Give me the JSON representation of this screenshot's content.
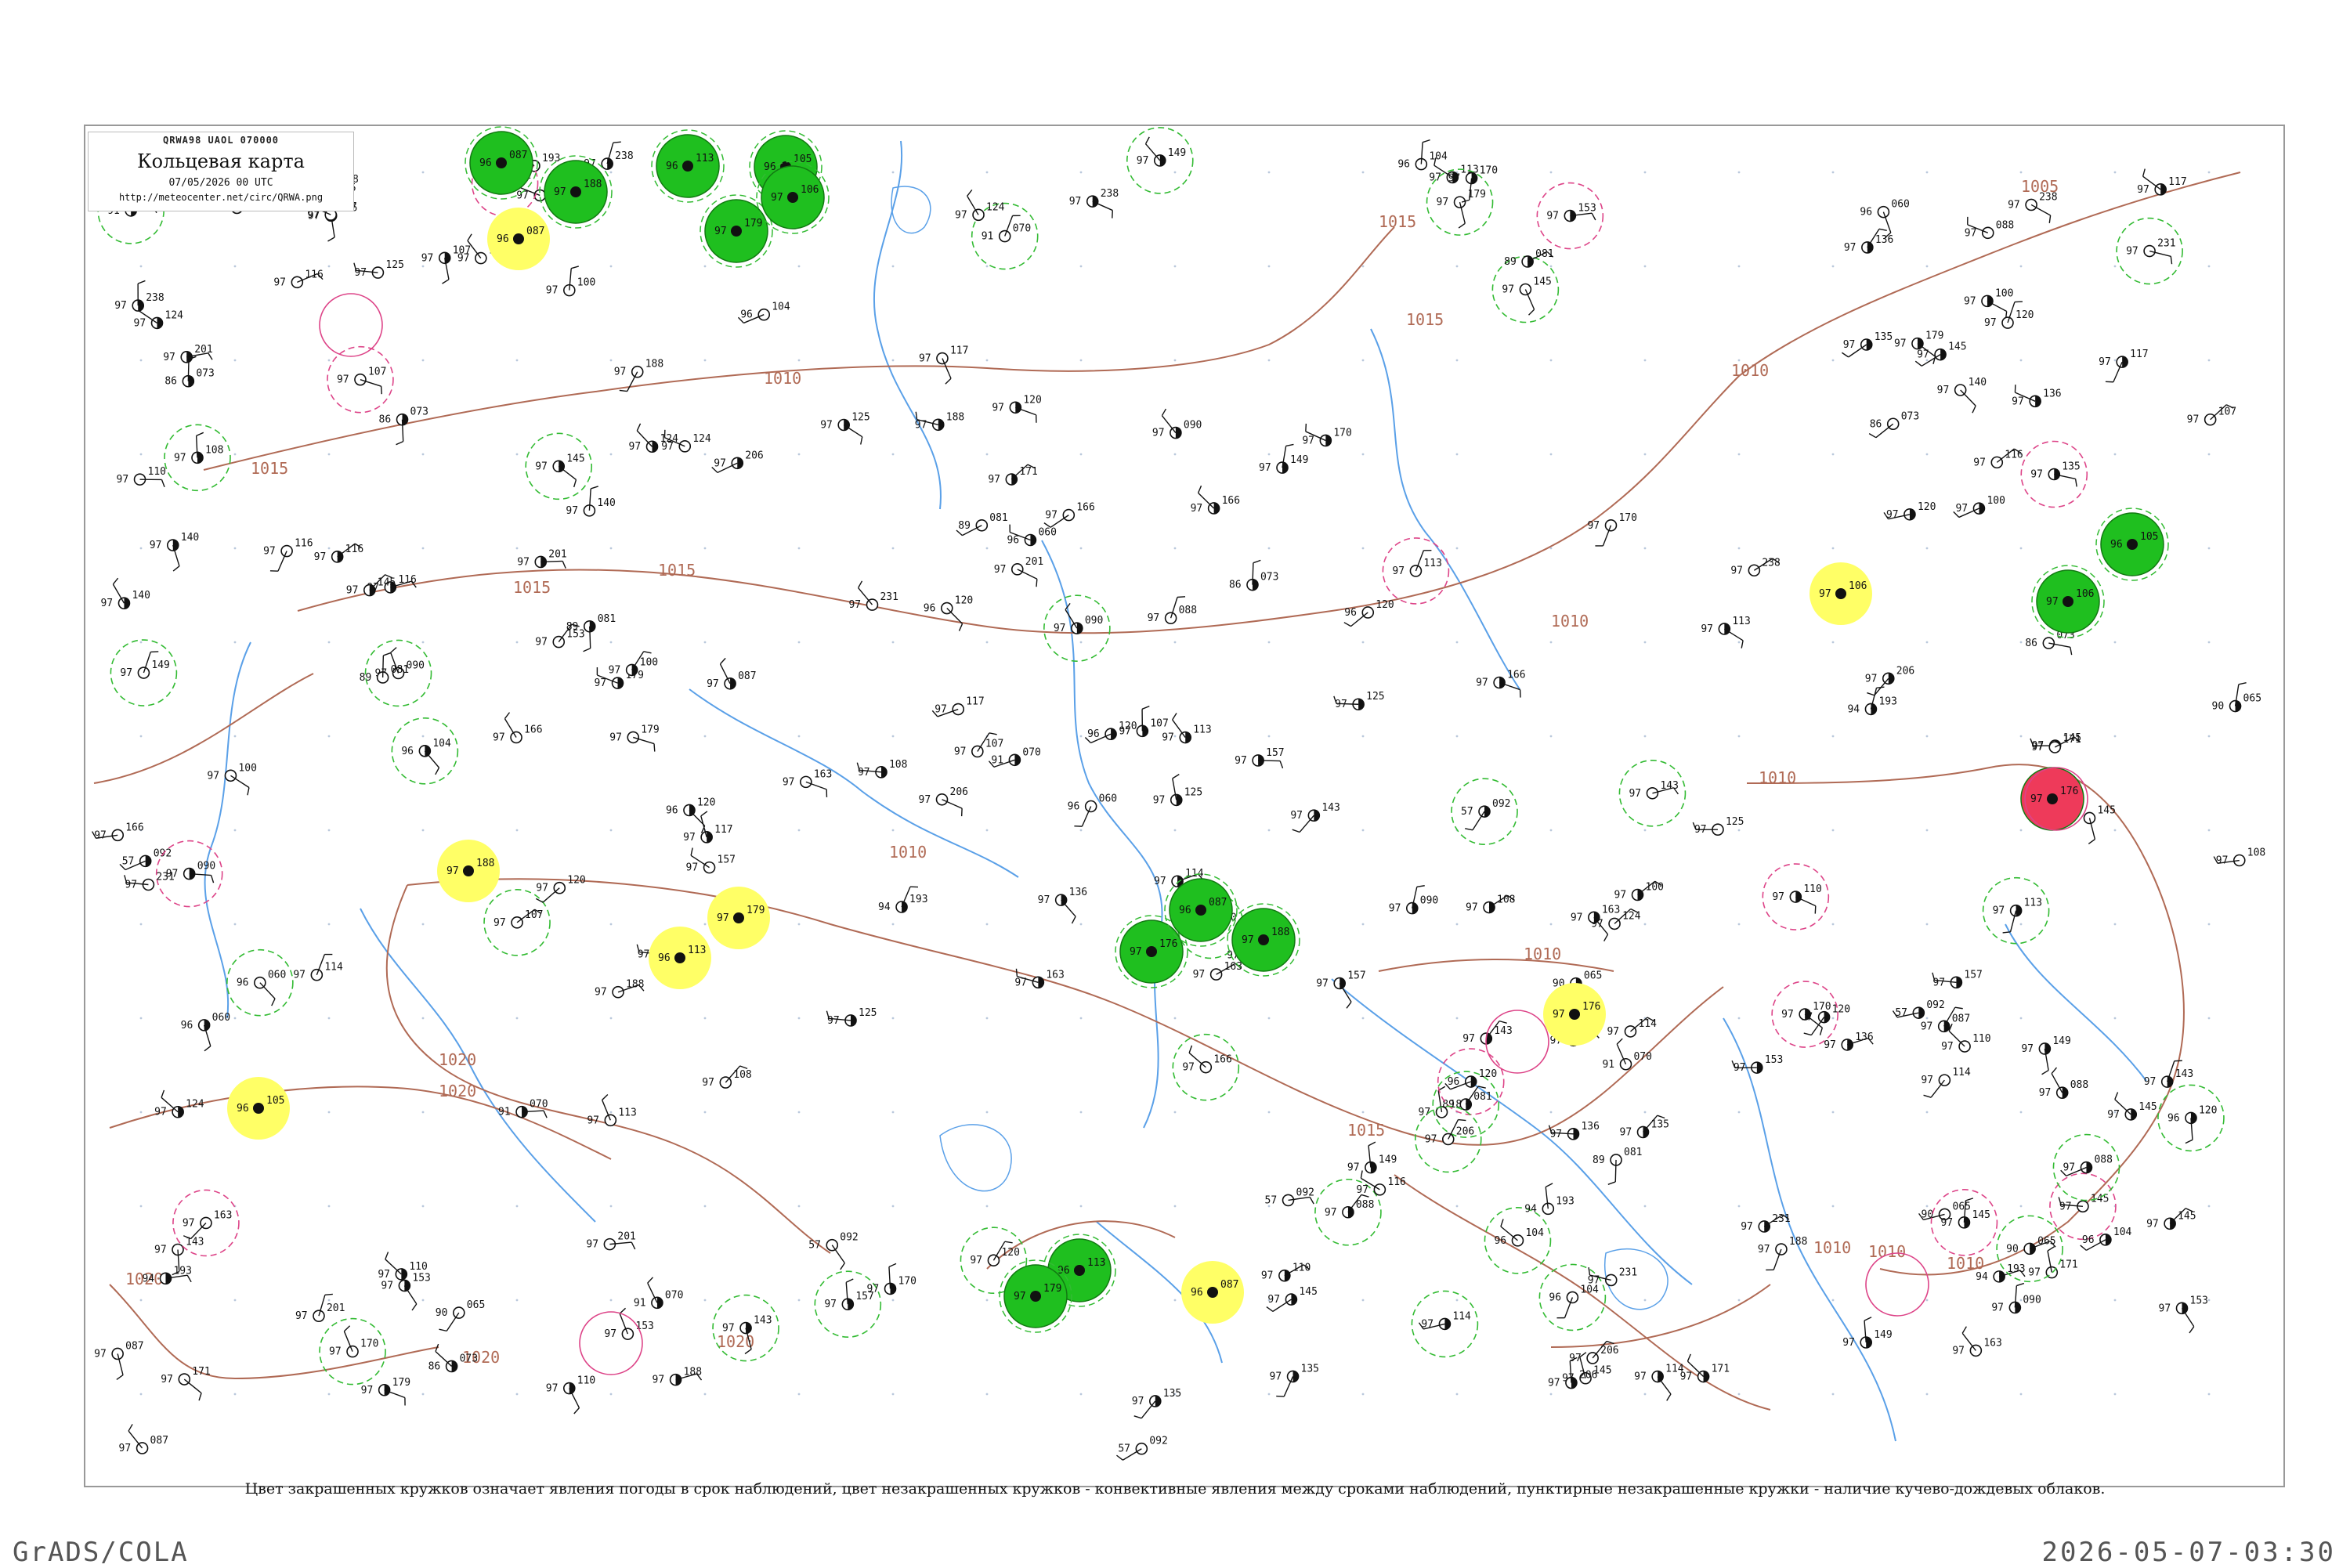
{
  "header": {
    "code": "QRWA98  UAOL  070000",
    "title": "Кольцевая карта",
    "date": "07/05/2026 00 UTC",
    "url": "http://meteocenter.net/circ/QRWA.png"
  },
  "caption": "Цвет закрашенных кружков означает явления погоды в срок наблюдений, цвет незакрашенных кружков - конвективные явления между сроками наблюдений, пунктирные незакрашенные кружки - наличие кучево-дождевых облаков.",
  "footer": {
    "left": "GrADS/COLA",
    "right": "2026-05-07-03:30"
  },
  "colors": {
    "green_fill": "#1fbf1f",
    "yellow_fill": "#ffff66",
    "red_fill": "#ee3a5a",
    "isobar": "#b06a55",
    "river": "#5aa0e8",
    "dashed_ring": "#33bb33",
    "pink_ring": "#dd4488"
  },
  "isobar_labels": [
    "1015",
    "1010",
    "1005",
    "1015",
    "1010",
    "1010",
    "1015",
    "1010",
    "1020",
    "1020",
    "1020",
    "1020",
    "1010",
    "1015",
    "1010",
    "1010",
    "1015",
    "1020",
    "1010",
    "1010",
    "1015"
  ],
  "stations": [
    {
      "label": "087",
      "sub": "97"
    },
    {
      "label": "073",
      "sub": "86"
    },
    {
      "label": "065",
      "sub": "90"
    },
    {
      "label": "070",
      "sub": "91"
    },
    {
      "label": "145",
      "sub": "97"
    },
    {
      "label": "108",
      "sub": "97"
    },
    {
      "label": "092",
      "sub": "57"
    },
    {
      "label": "060",
      "sub": "96"
    },
    {
      "label": "088",
      "sub": "97"
    },
    {
      "label": "120",
      "sub": "97"
    },
    {
      "label": "125",
      "sub": "97"
    },
    {
      "label": "081",
      "sub": "89"
    },
    {
      "label": "135",
      "sub": "97"
    },
    {
      "label": "157",
      "sub": "97"
    },
    {
      "label": "145",
      "sub": "97"
    },
    {
      "label": "120",
      "sub": "96"
    },
    {
      "label": "100",
      "sub": "97"
    },
    {
      "label": "107",
      "sub": "97"
    },
    {
      "label": "104",
      "sub": "96"
    },
    {
      "label": "090",
      "sub": "97"
    },
    {
      "label": "110",
      "sub": "97"
    },
    {
      "label": "113",
      "sub": "97"
    },
    {
      "label": "116",
      "sub": "97"
    },
    {
      "label": "149",
      "sub": "97"
    },
    {
      "label": "136",
      "sub": "97"
    },
    {
      "label": "124",
      "sub": "97"
    },
    {
      "label": "153",
      "sub": "97"
    },
    {
      "label": "170",
      "sub": "97"
    },
    {
      "label": "193",
      "sub": "94"
    },
    {
      "label": "171",
      "sub": "97"
    },
    {
      "label": "179",
      "sub": "97"
    },
    {
      "label": "188",
      "sub": "97"
    },
    {
      "label": "201",
      "sub": "97"
    },
    {
      "label": "163",
      "sub": "97"
    },
    {
      "label": "114",
      "sub": "97"
    },
    {
      "label": "166",
      "sub": "97"
    },
    {
      "label": "143",
      "sub": "97"
    },
    {
      "label": "140",
      "sub": "97"
    },
    {
      "label": "206",
      "sub": "97"
    },
    {
      "label": "231",
      "sub": "97"
    },
    {
      "label": "117",
      "sub": "97"
    },
    {
      "label": "238",
      "sub": "97"
    }
  ],
  "highlights": [
    {
      "label": "087",
      "sub": "96"
    },
    {
      "label": "188",
      "sub": "97"
    },
    {
      "label": "113",
      "sub": "96"
    },
    {
      "label": "179",
      "sub": "97"
    },
    {
      "label": "105",
      "sub": "96"
    },
    {
      "label": "106",
      "sub": "97"
    },
    {
      "label": "176",
      "sub": "97"
    }
  ]
}
